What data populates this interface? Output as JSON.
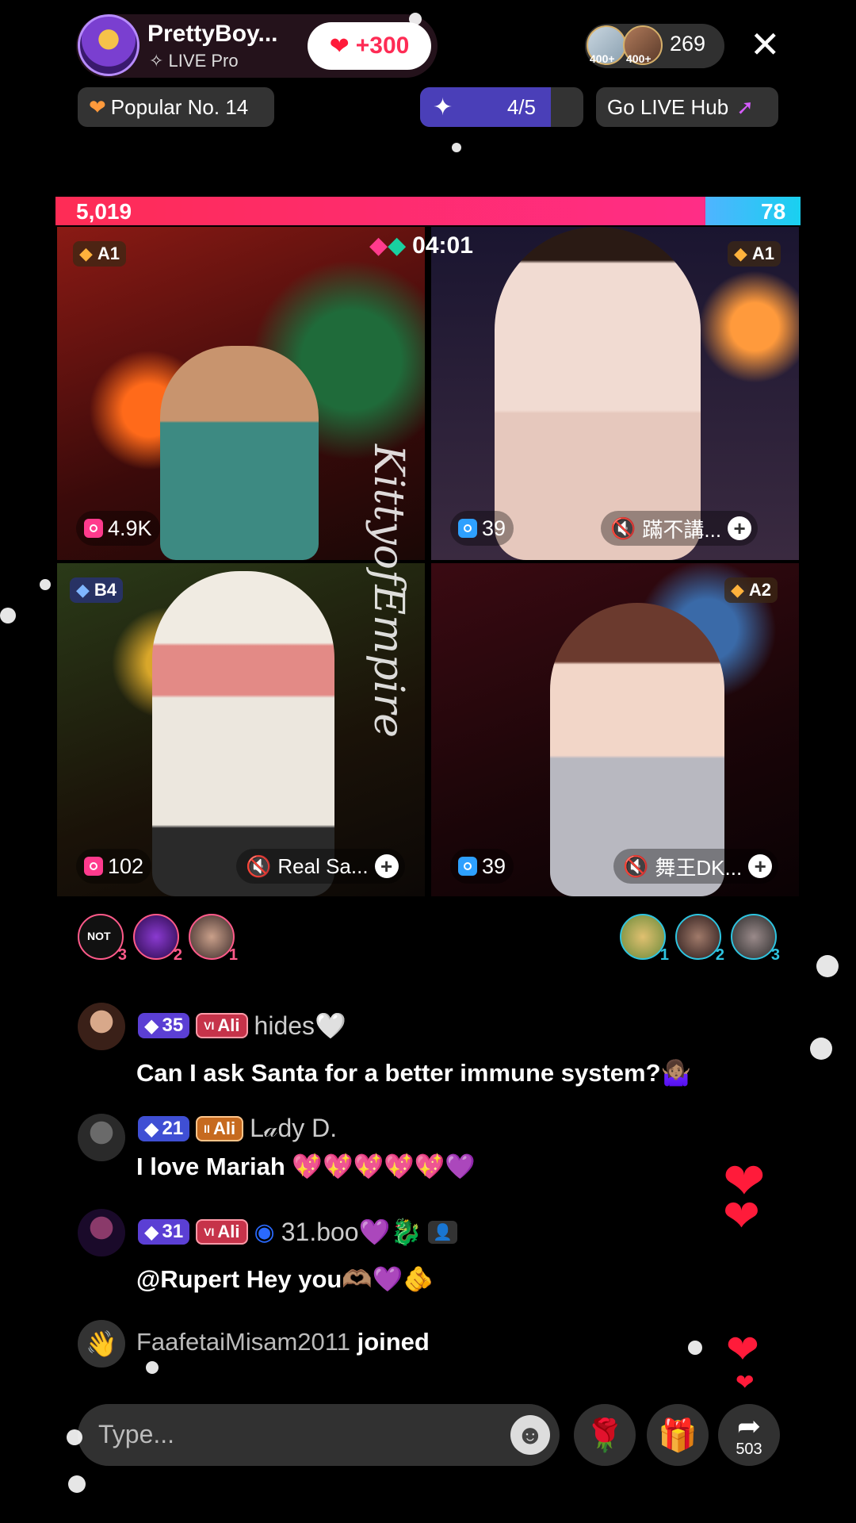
{
  "host": {
    "name": "PrettyBoy...",
    "subtitle": "LIVE Pro",
    "like_label": "+300"
  },
  "viewers": {
    "count": "269",
    "badge1": "400+",
    "badge2": "400+"
  },
  "chips": {
    "popular": "Popular No. 14",
    "progress": "4/5",
    "progress_fraction": 0.8,
    "hub": "Go LIVE Hub"
  },
  "battle": {
    "score_left": "5,019",
    "score_right": "78",
    "timer": "04:01",
    "watermark": "KittyofEmpire",
    "tiles": [
      {
        "badge": "A1",
        "stat": "4.9K",
        "name": ""
      },
      {
        "badge": "A1",
        "stat": "39",
        "name": "蹣不講..."
      },
      {
        "badge": "B4",
        "stat": "102",
        "name": "Real Sa..."
      },
      {
        "badge": "A2",
        "stat": "39",
        "name": "舞王DK..."
      }
    ]
  },
  "gifters_left": [
    {
      "label": "NOT",
      "rank": "3"
    },
    {
      "rank": "2"
    },
    {
      "rank": "1"
    }
  ],
  "gifters_right": [
    {
      "rank": "1"
    },
    {
      "rank": "2"
    },
    {
      "rank": "3"
    }
  ],
  "chat": [
    {
      "level": "35",
      "fan": "Ali",
      "fan_tag": "VI",
      "user": "hides🤍",
      "message": "Can I ask Santa for a better immune system?🤷🏽‍♀️"
    },
    {
      "level": "21",
      "fan": "Ali",
      "fan_tag": "II",
      "user": "L𝒶dy D.",
      "message": "I love Mariah 💖💖💖💖💖💜"
    },
    {
      "level": "31",
      "fan": "Ali",
      "fan_tag": "VI",
      "user": "31.boo💜🐉",
      "message": "@Rupert Hey you🫶🏽💜🫵"
    }
  ],
  "joined": {
    "user": "FaafetaiMisam2011",
    "suffix": "joined"
  },
  "input": {
    "placeholder": "Type..."
  },
  "share_count": "503",
  "icons": [
    "close-icon",
    "heart-icon",
    "spark-icon",
    "camera-icon",
    "mute-icon",
    "plus-icon",
    "diamond-icon",
    "emoji-icon",
    "rose-icon",
    "gift-icon",
    "share-icon",
    "wave-icon"
  ],
  "colors": {
    "accent_red": "#fe2c55",
    "accent_blue": "#19c6f0",
    "level_purple": "#5b3fd4"
  }
}
